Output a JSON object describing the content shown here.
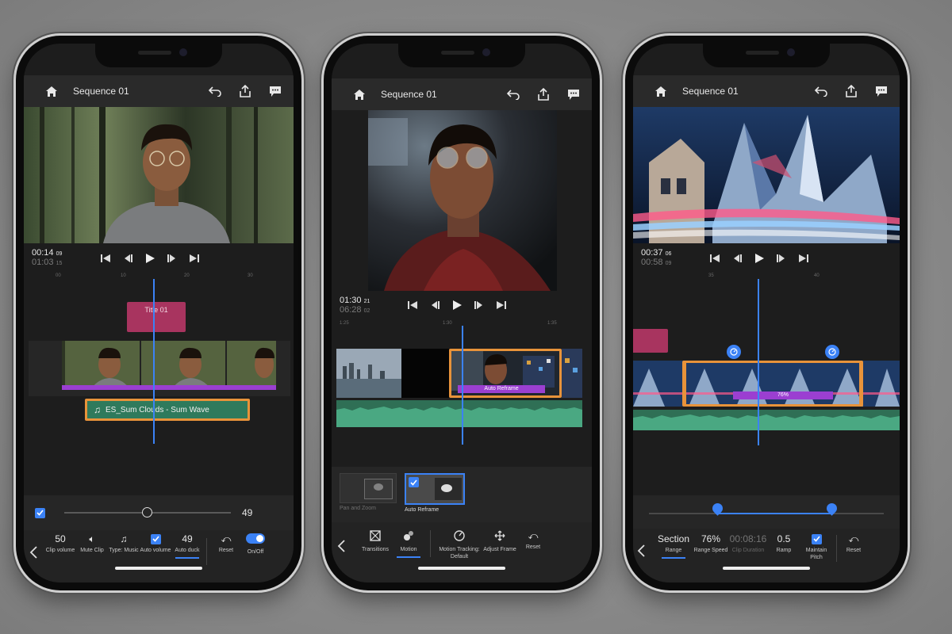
{
  "colors": {
    "accent": "#3b82f6",
    "clip_purple": "#9b3fd1",
    "clip_orange": "#e8933a",
    "audio_green": "#3d8a68",
    "title_clip": "#a8345f",
    "panel_bg": "#1d1d1d"
  },
  "phone1": {
    "title": "Sequence 01",
    "timecode": {
      "current": "00:14",
      "current_frames": "09",
      "duration": "01:03",
      "duration_frames": "15"
    },
    "ruler": [
      "00",
      "10",
      "20",
      "30"
    ],
    "title_clip": "Title 01",
    "audio_clip": "ES_Sum Clouds - Sum Wave",
    "slider_value": "49",
    "toolbar": [
      {
        "value": "50",
        "label": "Clip volume"
      },
      {
        "icon": "speaker-icon",
        "label": "Mute Clip"
      },
      {
        "icon": "music-note-icon",
        "label": "Type: Music"
      },
      {
        "icon": "checkbox-icon",
        "label": "Auto volume"
      },
      {
        "value": "49",
        "label": "Auto duck"
      },
      {
        "icon": "reset-icon",
        "label": "Reset"
      },
      {
        "icon": "toggle-icon",
        "label": "On/Off"
      }
    ]
  },
  "phone2": {
    "title": "Sequence 01",
    "timecode": {
      "current": "01:30",
      "current_frames": "21",
      "duration": "06:28",
      "duration_frames": "02"
    },
    "ruler": [
      "1:25",
      "1:30",
      "1:35"
    ],
    "clip_label": "Auto Reframe",
    "motion_options": [
      {
        "label": "Pan and Zoom",
        "selected": false
      },
      {
        "label": "Auto Reframe",
        "selected": true
      }
    ],
    "toolbar": [
      {
        "icon": "transitions-icon",
        "label": "Transitions"
      },
      {
        "icon": "motion-icon",
        "label": "Motion"
      },
      {
        "icon": "motion-tracking-icon",
        "label": "Motion Tracking: Default"
      },
      {
        "icon": "adjust-frame-icon",
        "label": "Adjust Frame"
      },
      {
        "icon": "reset-icon",
        "label": "Reset"
      }
    ]
  },
  "phone3": {
    "title": "Sequence 01",
    "timecode": {
      "current": "00:37",
      "current_frames": "06",
      "duration": "00:58",
      "duration_frames": "09"
    },
    "ruler": [
      "35",
      "40"
    ],
    "speed_label": "76%",
    "toolbar": [
      {
        "value": "Section",
        "label": "Range"
      },
      {
        "value": "76%",
        "label": "Range Speed"
      },
      {
        "value": "00:08:16",
        "label": "Clip Duration"
      },
      {
        "value": "0.5",
        "label": "Ramp"
      },
      {
        "icon": "checkbox-icon",
        "label": "Maintain Pitch"
      },
      {
        "icon": "reset-icon",
        "label": "Reset"
      }
    ]
  }
}
